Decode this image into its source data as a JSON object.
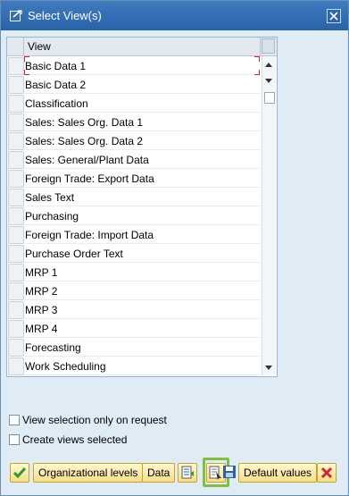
{
  "window": {
    "title": "Select View(s)"
  },
  "table": {
    "column_header": "View",
    "rows": [
      "Basic Data 1",
      "Basic Data 2",
      "Classification",
      "Sales: Sales Org. Data 1",
      "Sales: Sales Org. Data 2",
      "Sales: General/Plant Data",
      "Foreign Trade: Export Data",
      "Sales Text",
      "Purchasing",
      "Foreign Trade: Import Data",
      "Purchase Order Text",
      "MRP 1",
      "MRP 2",
      "MRP 3",
      "MRP 4",
      "Forecasting",
      "Work Scheduling"
    ]
  },
  "options": {
    "view_selection_only": "View selection only on request",
    "create_views_selected": "Create views selected"
  },
  "toolbar": {
    "org_levels": "Organizational levels",
    "data": "Data",
    "default_values": "Default values"
  },
  "colors": {
    "title_bar": "#2f6bb3",
    "button_yellow": "#f5e38e",
    "highlight_green": "#7fbf3d",
    "focus_red": "#d2232a"
  }
}
